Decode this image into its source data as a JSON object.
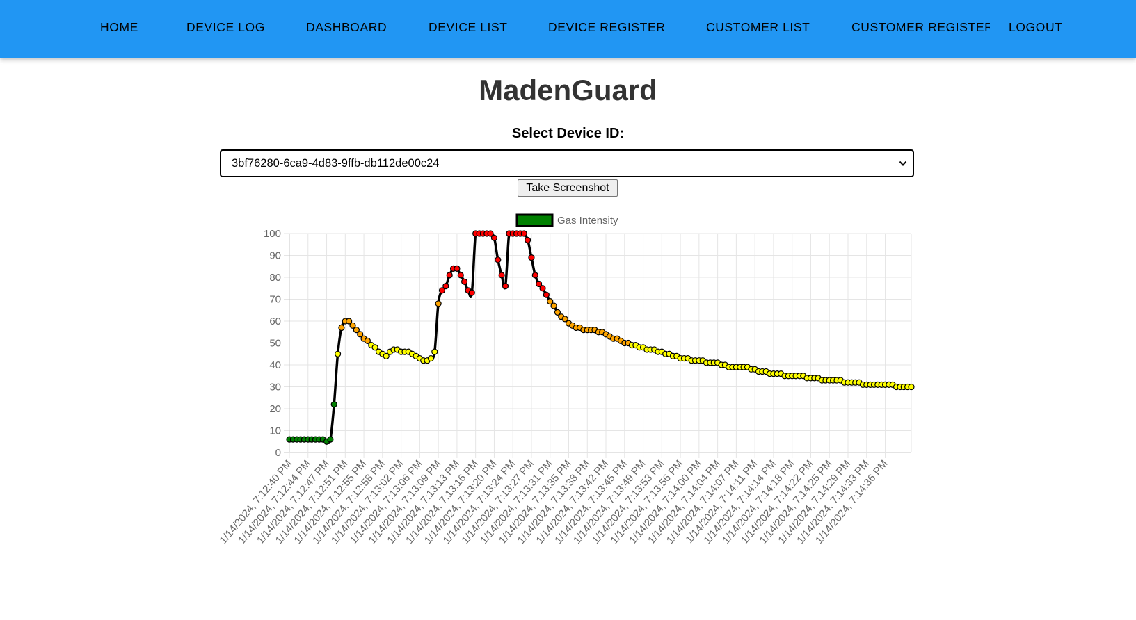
{
  "nav": {
    "home": "HOME",
    "device_log": "DEVICE LOG",
    "dashboard": "DASHBOARD",
    "device_list": "DEVICE LIST",
    "device_register": "DEVICE REGISTER",
    "customer_list": "CUSTOMER LIST",
    "customer_register": "CUSTOMER REGISTER",
    "logout": "LOGOUT"
  },
  "page": {
    "title": "MadenGuard",
    "select_label": "Select Device ID:",
    "selected_device": "3bf76280-6ca9-4d83-9ffb-db112de00c24",
    "screenshot_button": "Take Screenshot"
  },
  "colors": {
    "nav_bg": "#2196f3",
    "line": "#000000",
    "legend_fill": "#008000",
    "low": "#008000",
    "medium": "#ffff00",
    "high": "#ffa500",
    "critical": "#ff0000"
  },
  "chart_data": {
    "type": "line",
    "legend": [
      "Gas Intensity"
    ],
    "legend_position": "top",
    "grid": true,
    "ylim": [
      0,
      100
    ],
    "yticks": [
      0,
      10,
      20,
      30,
      40,
      50,
      60,
      70,
      80,
      90,
      100
    ],
    "xtick_labels": [
      "1/14/2024, 7:12:40 PM",
      "1/14/2024, 7:12:44 PM",
      "1/14/2024, 7:12:47 PM",
      "1/14/2024, 7:12:51 PM",
      "1/14/2024, 7:12:55 PM",
      "1/14/2024, 7:12:58 PM",
      "1/14/2024, 7:13:02 PM",
      "1/14/2024, 7:13:06 PM",
      "1/14/2024, 7:13:09 PM",
      "1/14/2024, 7:13:13 PM",
      "1/14/2024, 7:13:16 PM",
      "1/14/2024, 7:13:20 PM",
      "1/14/2024, 7:13:24 PM",
      "1/14/2024, 7:13:27 PM",
      "1/14/2024, 7:13:31 PM",
      "1/14/2024, 7:13:35 PM",
      "1/14/2024, 7:13:38 PM",
      "1/14/2024, 7:13:42 PM",
      "1/14/2024, 7:13:45 PM",
      "1/14/2024, 7:13:49 PM",
      "1/14/2024, 7:13:53 PM",
      "1/14/2024, 7:13:56 PM",
      "1/14/2024, 7:14:00 PM",
      "1/14/2024, 7:14:04 PM",
      "1/14/2024, 7:14:07 PM",
      "1/14/2024, 7:14:11 PM",
      "1/14/2024, 7:14:14 PM",
      "1/14/2024, 7:14:18 PM",
      "1/14/2024, 7:14:22 PM",
      "1/14/2024, 7:14:25 PM",
      "1/14/2024, 7:14:29 PM",
      "1/14/2024, 7:14:33 PM",
      "1/14/2024, 7:14:36 PM"
    ],
    "points_per_label": 5,
    "series": [
      {
        "name": "Gas Intensity",
        "values": [
          6,
          6,
          6,
          6,
          6,
          6,
          6,
          6,
          6,
          6,
          5,
          6,
          22,
          45,
          57,
          60,
          60,
          58,
          56,
          54,
          52,
          51,
          49,
          48,
          46,
          45,
          44,
          46,
          47,
          47,
          46,
          46,
          46,
          45,
          44,
          43,
          42,
          42,
          43,
          46,
          68,
          74,
          76,
          81,
          84,
          84,
          81,
          78,
          74,
          73,
          100,
          100,
          100,
          100,
          100,
          98,
          88,
          81,
          76,
          100,
          100,
          100,
          100,
          100,
          97,
          89,
          81,
          77,
          75,
          72,
          69,
          67,
          64,
          62,
          61,
          59,
          58,
          57,
          57,
          56,
          56,
          56,
          56,
          55,
          55,
          54,
          53,
          52,
          52,
          51,
          50,
          50,
          49,
          49,
          48,
          48,
          47,
          47,
          47,
          46,
          46,
          45,
          45,
          44,
          44,
          43,
          43,
          43,
          42,
          42,
          42,
          42,
          41,
          41,
          41,
          41,
          40,
          40,
          39,
          39,
          39,
          39,
          39,
          39,
          38,
          38,
          37,
          37,
          37,
          36,
          36,
          36,
          36,
          35,
          35,
          35,
          35,
          35,
          35,
          34,
          34,
          34,
          34,
          33,
          33,
          33,
          33,
          33,
          33,
          32,
          32,
          32,
          32,
          32,
          31,
          31,
          31,
          31,
          31,
          31,
          31,
          31,
          31,
          30,
          30,
          30,
          30,
          30
        ],
        "point_colors_by_value": {
          "below_25": "low",
          "25_to_49": "medium",
          "50_to_69": "high",
          "70_and_above": "critical"
        }
      }
    ]
  }
}
